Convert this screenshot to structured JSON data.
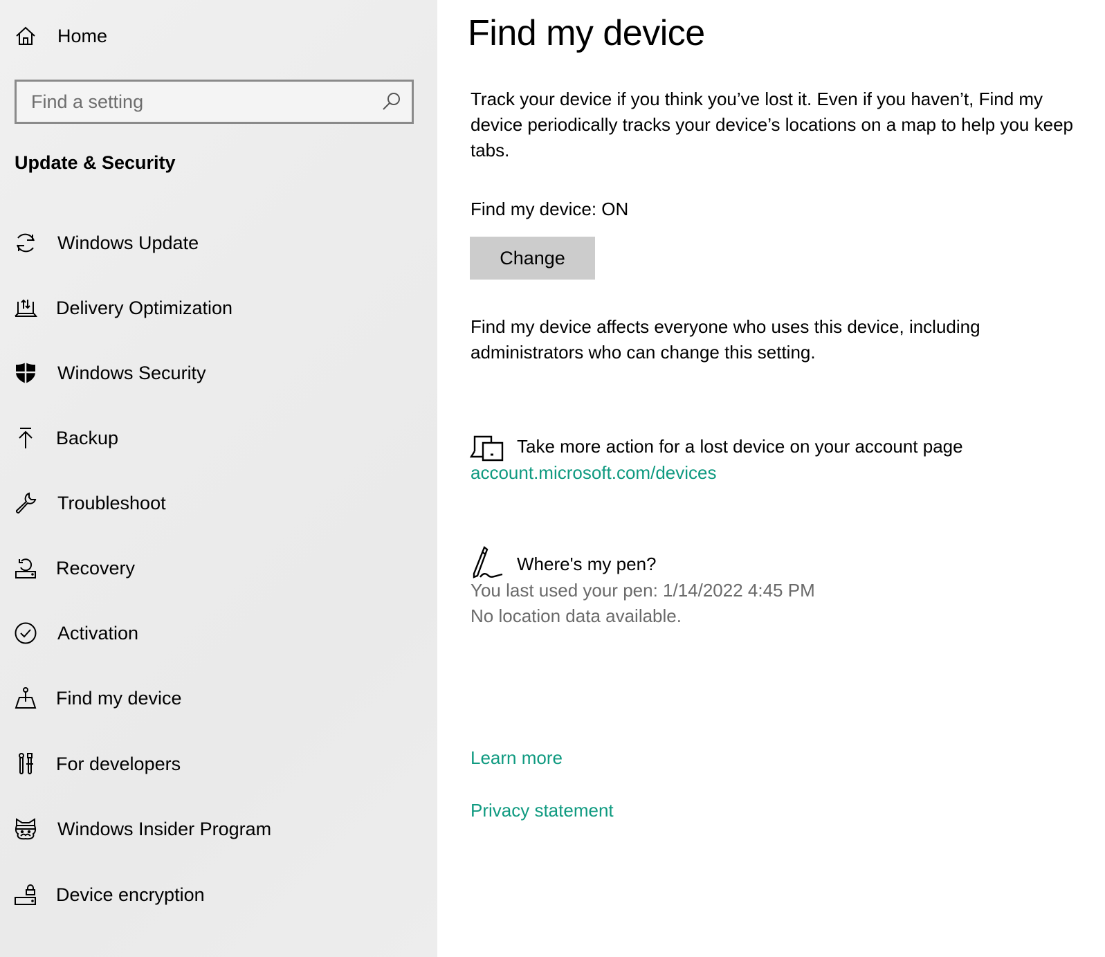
{
  "sidebar": {
    "home_label": "Home",
    "search": {
      "placeholder": "Find a setting",
      "value": ""
    },
    "section_title": "Update & Security",
    "items": [
      {
        "label": "Windows Update",
        "icon": "sync-icon"
      },
      {
        "label": "Delivery Optimization",
        "icon": "delivery-optimization-icon"
      },
      {
        "label": "Windows Security",
        "icon": "shield-icon"
      },
      {
        "label": "Backup",
        "icon": "upload-arrow-icon"
      },
      {
        "label": "Troubleshoot",
        "icon": "wrench-icon"
      },
      {
        "label": "Recovery",
        "icon": "recovery-icon"
      },
      {
        "label": "Activation",
        "icon": "check-circle-icon"
      },
      {
        "label": "Find my device",
        "icon": "find-device-icon"
      },
      {
        "label": "For developers",
        "icon": "developer-tools-icon"
      },
      {
        "label": "Windows Insider Program",
        "icon": "ninja-cat-icon"
      },
      {
        "label": "Device encryption",
        "icon": "drive-lock-icon"
      }
    ],
    "selected_item": "Find my device"
  },
  "main": {
    "title": "Find my device",
    "description": "Track your device if you think you’ve lost it. Even if you haven’t, Find my device periodically tracks your device’s locations on a map to help you keep tabs.",
    "status_text": "Find my device: ON",
    "change_button_label": "Change",
    "affects_note": "Find my device affects everyone who uses this device, including administrators who can change this setting.",
    "account_action": {
      "label": "Take more action for a lost device on your account page",
      "link": "account.microsoft.com/devices",
      "icon": "devices-icon"
    },
    "pen": {
      "title": "Where's my pen?",
      "last_used": "You last used your pen: 1/14/2022 4:45 PM",
      "location": "No location data available.",
      "icon": "pen-icon"
    },
    "learn_more": "Learn more",
    "privacy_statement": "Privacy statement"
  },
  "colors": {
    "link": "#0f9a80",
    "button_bg": "#cccccc",
    "secondary_text": "#6a6a6a",
    "sidebar_bg": "#ececec"
  }
}
